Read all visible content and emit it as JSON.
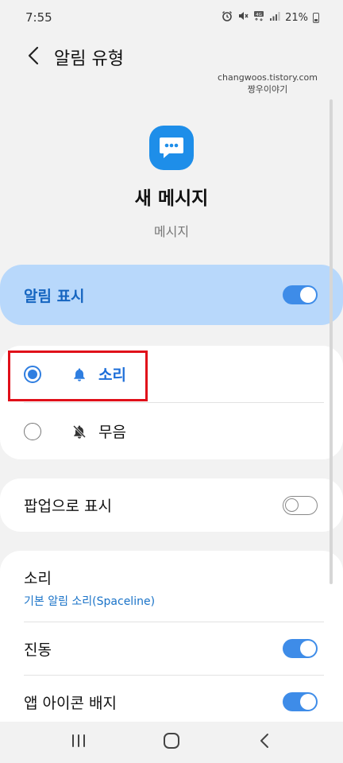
{
  "status_bar": {
    "time": "7:55",
    "battery": "21%"
  },
  "app_bar": {
    "title": "알림 유형"
  },
  "watermark": {
    "line1": "changwoos.tistory.com",
    "line2": "짱우이야기"
  },
  "channel": {
    "title": "새 메시지",
    "subtitle": "메시지"
  },
  "show_notifications": {
    "label": "알림 표시",
    "enabled": true
  },
  "alert_options": [
    {
      "label": "소리",
      "icon": "bell-icon",
      "selected": true
    },
    {
      "label": "무음",
      "icon": "bell-off-icon",
      "selected": false
    }
  ],
  "popup": {
    "label": "팝업으로 표시",
    "enabled": false
  },
  "settings": {
    "sound": {
      "label": "소리",
      "value": "기본 알림 소리(Spaceline)"
    },
    "vibration": {
      "label": "진동",
      "enabled": true
    },
    "badge": {
      "label": "앱 아이콘 배지",
      "enabled": true
    }
  },
  "colors": {
    "accent": "#3e8ce8",
    "highlight_band": "#b8d8fb",
    "annotation": "#e0101a"
  }
}
